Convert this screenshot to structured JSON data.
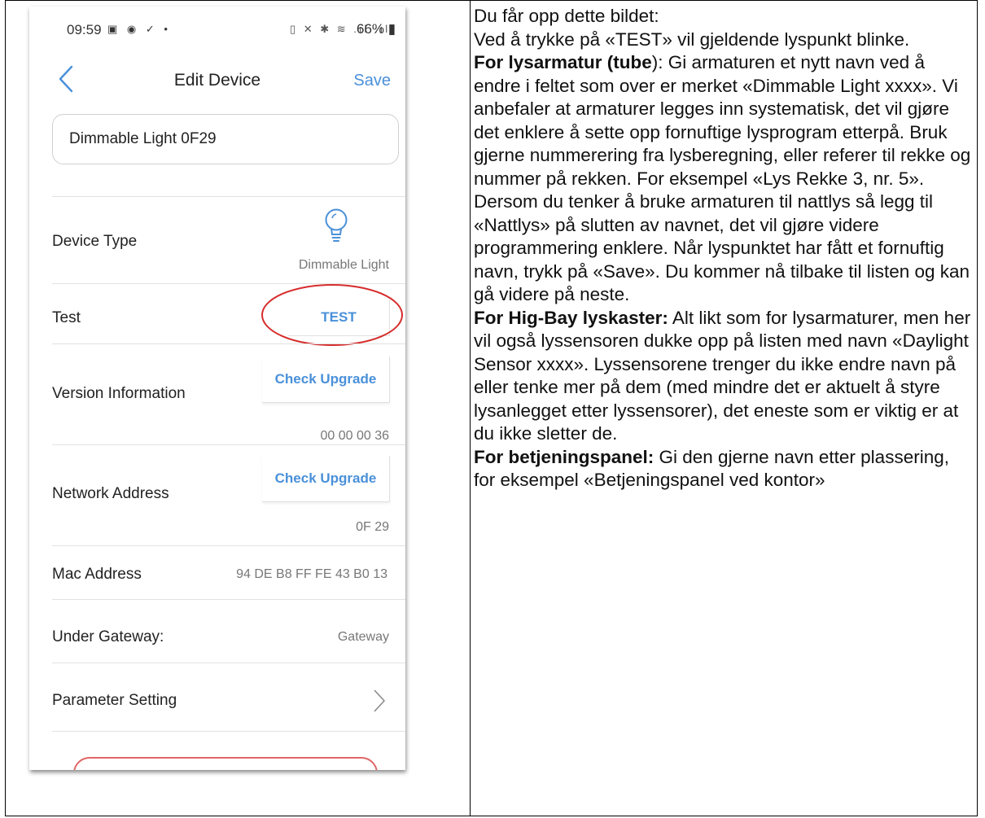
{
  "phone": {
    "status_bar": {
      "time": "09:59",
      "left_icons": "▣ ◉ ✓ •",
      "right_icons": "▯ ✕ ✱ ≋ .ıl .ıl",
      "battery": "66%"
    },
    "nav": {
      "title": "Edit Device",
      "save_label": "Save"
    },
    "device_name_value": "Dimmable Light 0F29",
    "rows": {
      "device_type": {
        "label": "Device Type",
        "value": "Dimmable Light"
      },
      "test": {
        "label": "Test",
        "button_label": "TEST"
      },
      "version": {
        "label": "Version Information",
        "button_label": "Check Upgrade",
        "value": "00 00 00 36"
      },
      "network": {
        "label": "Network Address",
        "button_label": "Check Upgrade",
        "value": "0F 29"
      },
      "mac": {
        "label": "Mac Address",
        "value": "94 DE B8 FF FE 43 B0 13"
      },
      "gateway": {
        "label": "Under Gateway:",
        "value": "Gateway"
      },
      "parameter": {
        "label": "Parameter Setting"
      }
    },
    "colors": {
      "accent": "#4a90d9",
      "highlight": "#d62c2c"
    }
  },
  "instructions": {
    "intro": "Du får opp dette bildet:",
    "test_note": "Ved å trykke på «TEST» vil gjeldende lyspunkt blinke.",
    "tube_heading": "For lysarmatur (tube",
    "tube_heading_end": "):",
    "tube_text": " Gi armaturen et nytt navn ved å endre i feltet som over er merket «Dimmable Light xxxx». Vi anbefaler at armaturer legges inn systematisk, det vil gjøre det enklere å sette opp fornuftige lysprogram etterpå. Bruk gjerne nummerering fra lysberegning, eller referer til rekke og nummer på rekken. For eksempel «Lys Rekke 3, nr. 5». Dersom du tenker å bruke armaturen til nattlys så legg til «Nattlys» på slutten av navnet, det vil gjøre videre programmering enklere. Når lyspunktet har fått et fornuftig navn, trykk på «Save». Du kommer nå tilbake til listen og kan gå videre på neste.",
    "highbay_heading": "For Hig-Bay lyskaster:",
    "highbay_text": " Alt likt som for lysarmaturer, men her vil også lyssensoren dukke opp på listen med navn «Daylight Sensor xxxx». Lyssensorene trenger du ikke endre navn på eller tenke mer på dem (med mindre det er aktuelt å styre lysanlegget etter lyssensorer), det eneste som er viktig er at du ikke sletter de.",
    "panel_heading": "For betjeningspanel:",
    "panel_text": " Gi den gjerne navn etter plassering, for eksempel «Betjeningspanel ved kontor»"
  }
}
